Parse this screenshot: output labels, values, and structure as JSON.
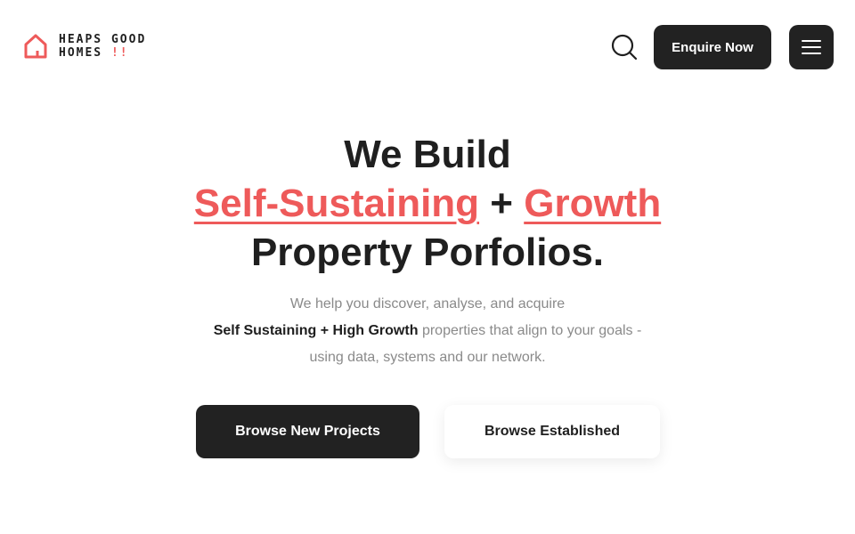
{
  "logo": {
    "line1": "HEAPS GOOD",
    "line2": "HOMES",
    "line2_accent": "!!",
    "icon": "house-icon",
    "accent_color": "#ee5a5a"
  },
  "header": {
    "search_icon": "search-icon",
    "enquire_label": "Enquire Now",
    "menu_icon": "hamburger-menu-icon"
  },
  "hero": {
    "line1": "We Build",
    "accent1": "Self-Sustaining",
    "plus": "+",
    "accent2": "Growth",
    "line3": "Property Porfolios.",
    "sub_line1": "We help you discover, analyse, and acquire",
    "sub_bold": "Self Sustaining + High Growth",
    "sub_line2_rest": "properties that align to your goals -",
    "sub_line3": "using data, systems and our network."
  },
  "buttons": {
    "primary_label": "Browse New Projects",
    "secondary_label": "Browse Established"
  },
  "colors": {
    "accent": "#ee5a5a",
    "dark": "#222222",
    "muted_text": "#8a8a8a"
  }
}
